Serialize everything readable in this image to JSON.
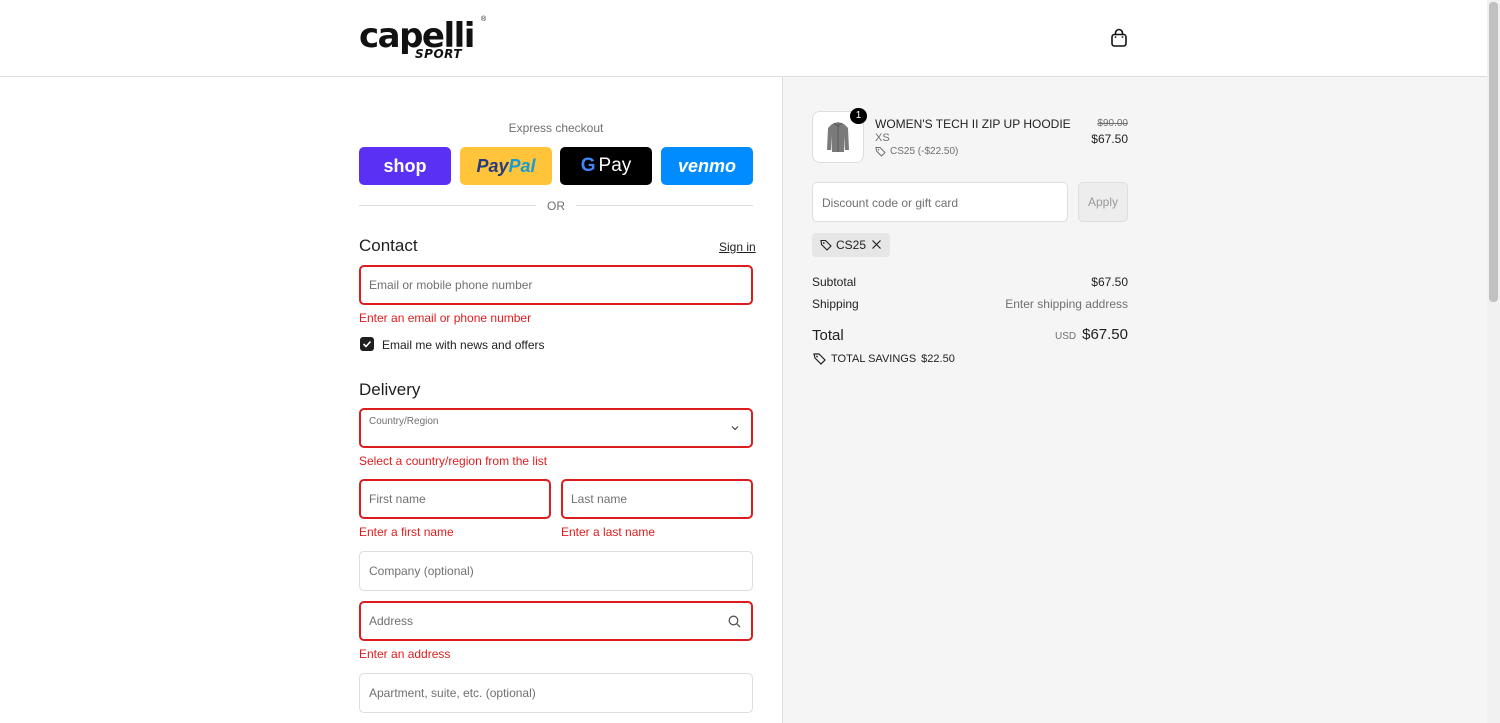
{
  "brand": {
    "name": "capelli",
    "sub": "SPORT",
    "reg": "®"
  },
  "express": {
    "label": "Express checkout",
    "buttons": {
      "shop": "shop",
      "paypal": "PayPal",
      "gpay": "G Pay",
      "venmo": "venmo"
    },
    "or": "OR"
  },
  "contact": {
    "title": "Contact",
    "signin": "Sign in",
    "email_placeholder": "Email or mobile phone number",
    "email_error": "Enter an email or phone number",
    "newsletter_label": "Email me with news and offers",
    "newsletter_checked": true
  },
  "delivery": {
    "title": "Delivery",
    "country_label": "Country/Region",
    "country_error": "Select a country/region from the list",
    "first_name_placeholder": "First name",
    "first_name_error": "Enter a first name",
    "last_name_placeholder": "Last name",
    "last_name_error": "Enter a last name",
    "company_placeholder": "Company (optional)",
    "address_placeholder": "Address",
    "address_error": "Enter an address",
    "apartment_placeholder": "Apartment, suite, etc. (optional)"
  },
  "summary": {
    "item": {
      "quantity": "1",
      "name": "WOMEN'S TECH II ZIP UP HOODIE",
      "variant": "XS",
      "discount": "CS25 (-$22.50)",
      "price_original": "$90.00",
      "price": "$67.50"
    },
    "discount_placeholder": "Discount code or gift card",
    "apply_label": "Apply",
    "applied_code": "CS25",
    "subtotal_label": "Subtotal",
    "subtotal_value": "$67.50",
    "shipping_label": "Shipping",
    "shipping_value": "Enter shipping address",
    "total_label": "Total",
    "total_currency": "USD",
    "total_value": "$67.50",
    "savings_label": "TOTAL SAVINGS",
    "savings_value": "$22.50"
  },
  "colors": {
    "error": "#dd1d1d",
    "shop": "#5a31f4",
    "paypal": "#ffc439",
    "gpay": "#000000",
    "venmo": "#008cff"
  }
}
